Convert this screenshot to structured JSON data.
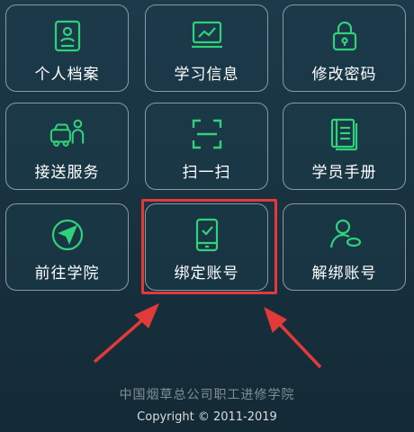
{
  "menu": {
    "items": [
      {
        "label": "个人档案",
        "icon": "profile-icon"
      },
      {
        "label": "学习信息",
        "icon": "study-chart-icon"
      },
      {
        "label": "修改密码",
        "icon": "lock-icon"
      },
      {
        "label": "接送服务",
        "icon": "shuttle-icon"
      },
      {
        "label": "扫一扫",
        "icon": "scan-icon"
      },
      {
        "label": "学员手册",
        "icon": "handbook-icon"
      },
      {
        "label": "前往学院",
        "icon": "navigate-icon"
      },
      {
        "label": "绑定账号",
        "icon": "bind-phone-icon"
      },
      {
        "label": "解绑账号",
        "icon": "unbind-user-icon"
      }
    ]
  },
  "footer": {
    "org": "中国烟草总公司职工进修学院",
    "copyright": "Copyright © 2011-2019"
  },
  "colors": {
    "icon": "#2fd27a",
    "highlight": "#e23a3a"
  }
}
